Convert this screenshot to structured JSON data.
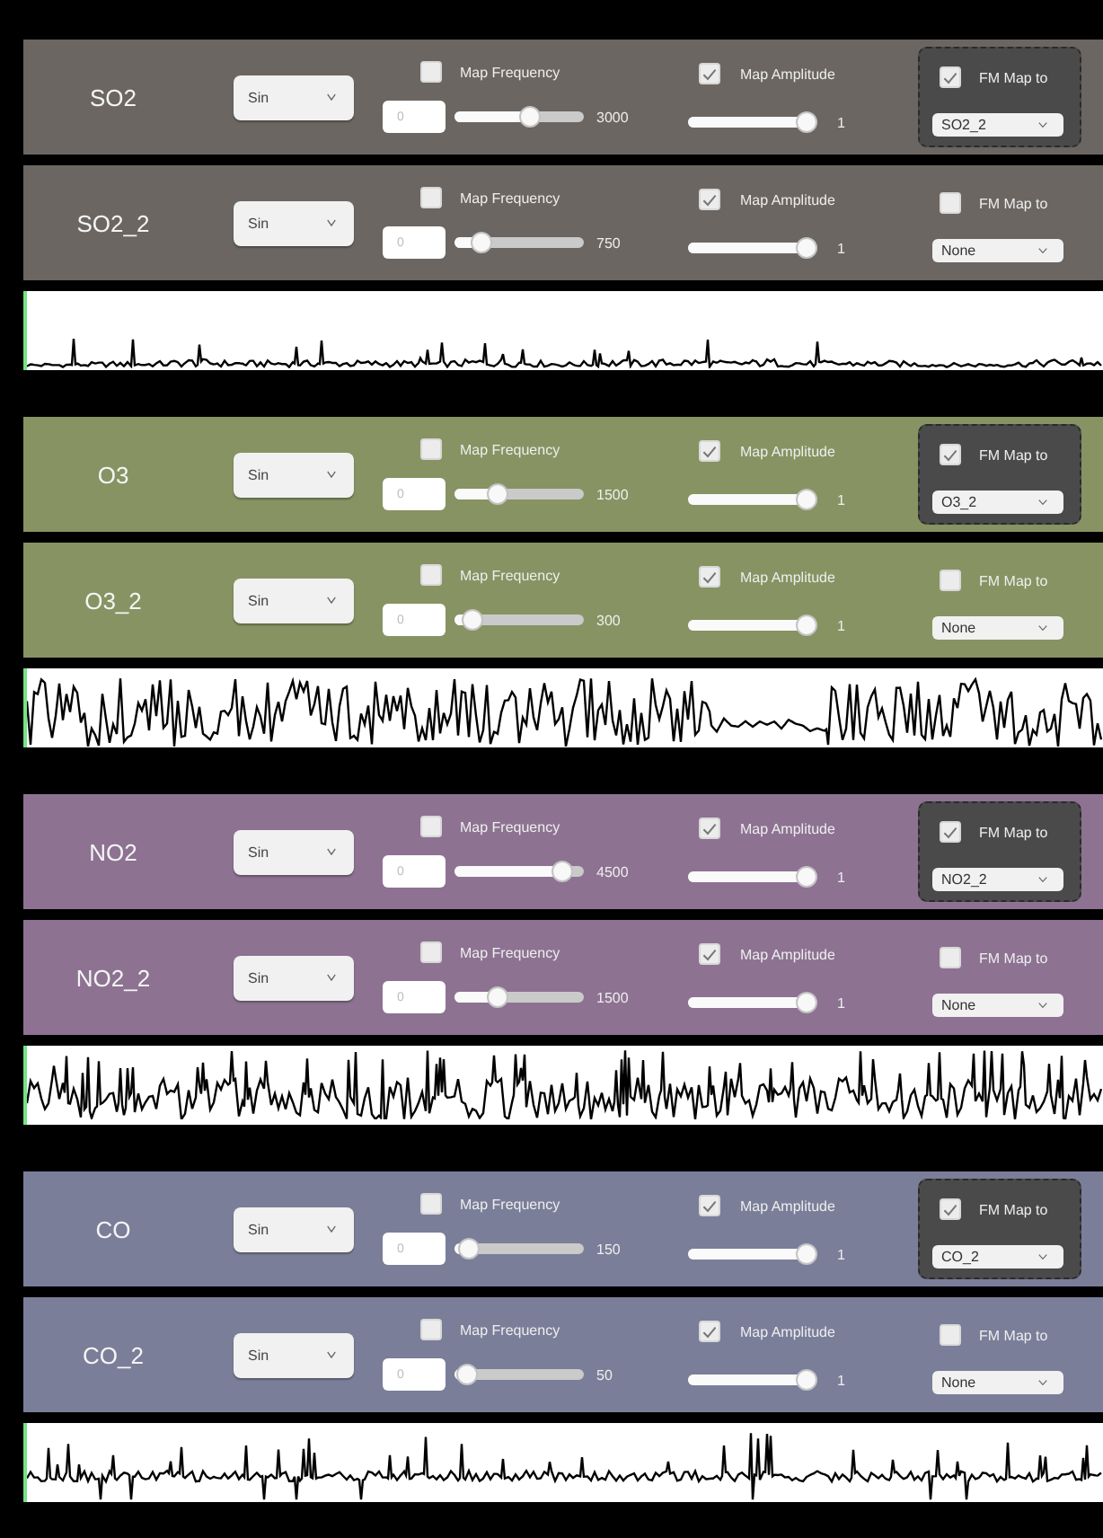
{
  "groups": [
    {
      "color": "#6b6661",
      "channels": [
        {
          "name": "SO2",
          "wave_type": "Sin",
          "frequency": {
            "label": "Map Frequency",
            "checked": false,
            "placeholder": "0",
            "level": 0.6,
            "reading": "3000"
          },
          "amplitude": {
            "label": "Map Amplitude",
            "checked": true,
            "level": 1,
            "reading": "1"
          },
          "fm": {
            "label": "FM Map to",
            "checked": true,
            "target": "SO2_2"
          }
        },
        {
          "name": "SO2_2",
          "wave_type": "Sin",
          "frequency": {
            "label": "Map Frequency",
            "checked": false,
            "placeholder": "0",
            "level": 0.15,
            "reading": "750"
          },
          "amplitude": {
            "label": "Map Amplitude",
            "checked": true,
            "level": 1,
            "reading": "1"
          },
          "fm": {
            "label": "FM Map to",
            "checked": false,
            "target": "None"
          }
        }
      ]
    },
    {
      "color": "#879362",
      "channels": [
        {
          "name": "O3",
          "wave_type": "Sin",
          "frequency": {
            "label": "Map Frequency",
            "checked": false,
            "placeholder": "0",
            "level": 0.3,
            "reading": "1500"
          },
          "amplitude": {
            "label": "Map Amplitude",
            "checked": true,
            "level": 1,
            "reading": "1"
          },
          "fm": {
            "label": "FM Map to",
            "checked": true,
            "target": "O3_2"
          }
        },
        {
          "name": "O3_2",
          "wave_type": "Sin",
          "frequency": {
            "label": "Map Frequency",
            "checked": false,
            "placeholder": "0",
            "level": 0.06,
            "reading": "300"
          },
          "amplitude": {
            "label": "Map Amplitude",
            "checked": true,
            "level": 1,
            "reading": "1"
          },
          "fm": {
            "label": "FM Map to",
            "checked": false,
            "target": "None"
          }
        }
      ]
    },
    {
      "color": "#8d7292",
      "channels": [
        {
          "name": "NO2",
          "wave_type": "Sin",
          "frequency": {
            "label": "Map Frequency",
            "checked": false,
            "placeholder": "0",
            "level": 0.9,
            "reading": "4500"
          },
          "amplitude": {
            "label": "Map Amplitude",
            "checked": true,
            "level": 1,
            "reading": "1"
          },
          "fm": {
            "label": "FM Map to",
            "checked": true,
            "target": "NO2_2"
          }
        },
        {
          "name": "NO2_2",
          "wave_type": "Sin",
          "frequency": {
            "label": "Map Frequency",
            "checked": false,
            "placeholder": "0",
            "level": 0.3,
            "reading": "1500"
          },
          "amplitude": {
            "label": "Map Amplitude",
            "checked": true,
            "level": 1,
            "reading": "1"
          },
          "fm": {
            "label": "FM Map to",
            "checked": false,
            "target": "None"
          }
        }
      ]
    },
    {
      "color": "#7a7e99",
      "channels": [
        {
          "name": "CO",
          "wave_type": "Sin",
          "frequency": {
            "label": "Map Frequency",
            "checked": false,
            "placeholder": "0",
            "level": 0.03,
            "reading": "150"
          },
          "amplitude": {
            "label": "Map Amplitude",
            "checked": true,
            "level": 1,
            "reading": "1"
          },
          "fm": {
            "label": "FM Map to",
            "checked": true,
            "target": "CO_2"
          }
        },
        {
          "name": "CO_2",
          "wave_type": "Sin",
          "frequency": {
            "label": "Map Frequency",
            "checked": false,
            "placeholder": "0",
            "level": 0.01,
            "reading": "50"
          },
          "amplitude": {
            "label": "Map Amplitude",
            "checked": true,
            "level": 1,
            "reading": "1"
          },
          "fm": {
            "label": "FM Map to",
            "checked": false,
            "target": "None"
          }
        }
      ]
    }
  ]
}
